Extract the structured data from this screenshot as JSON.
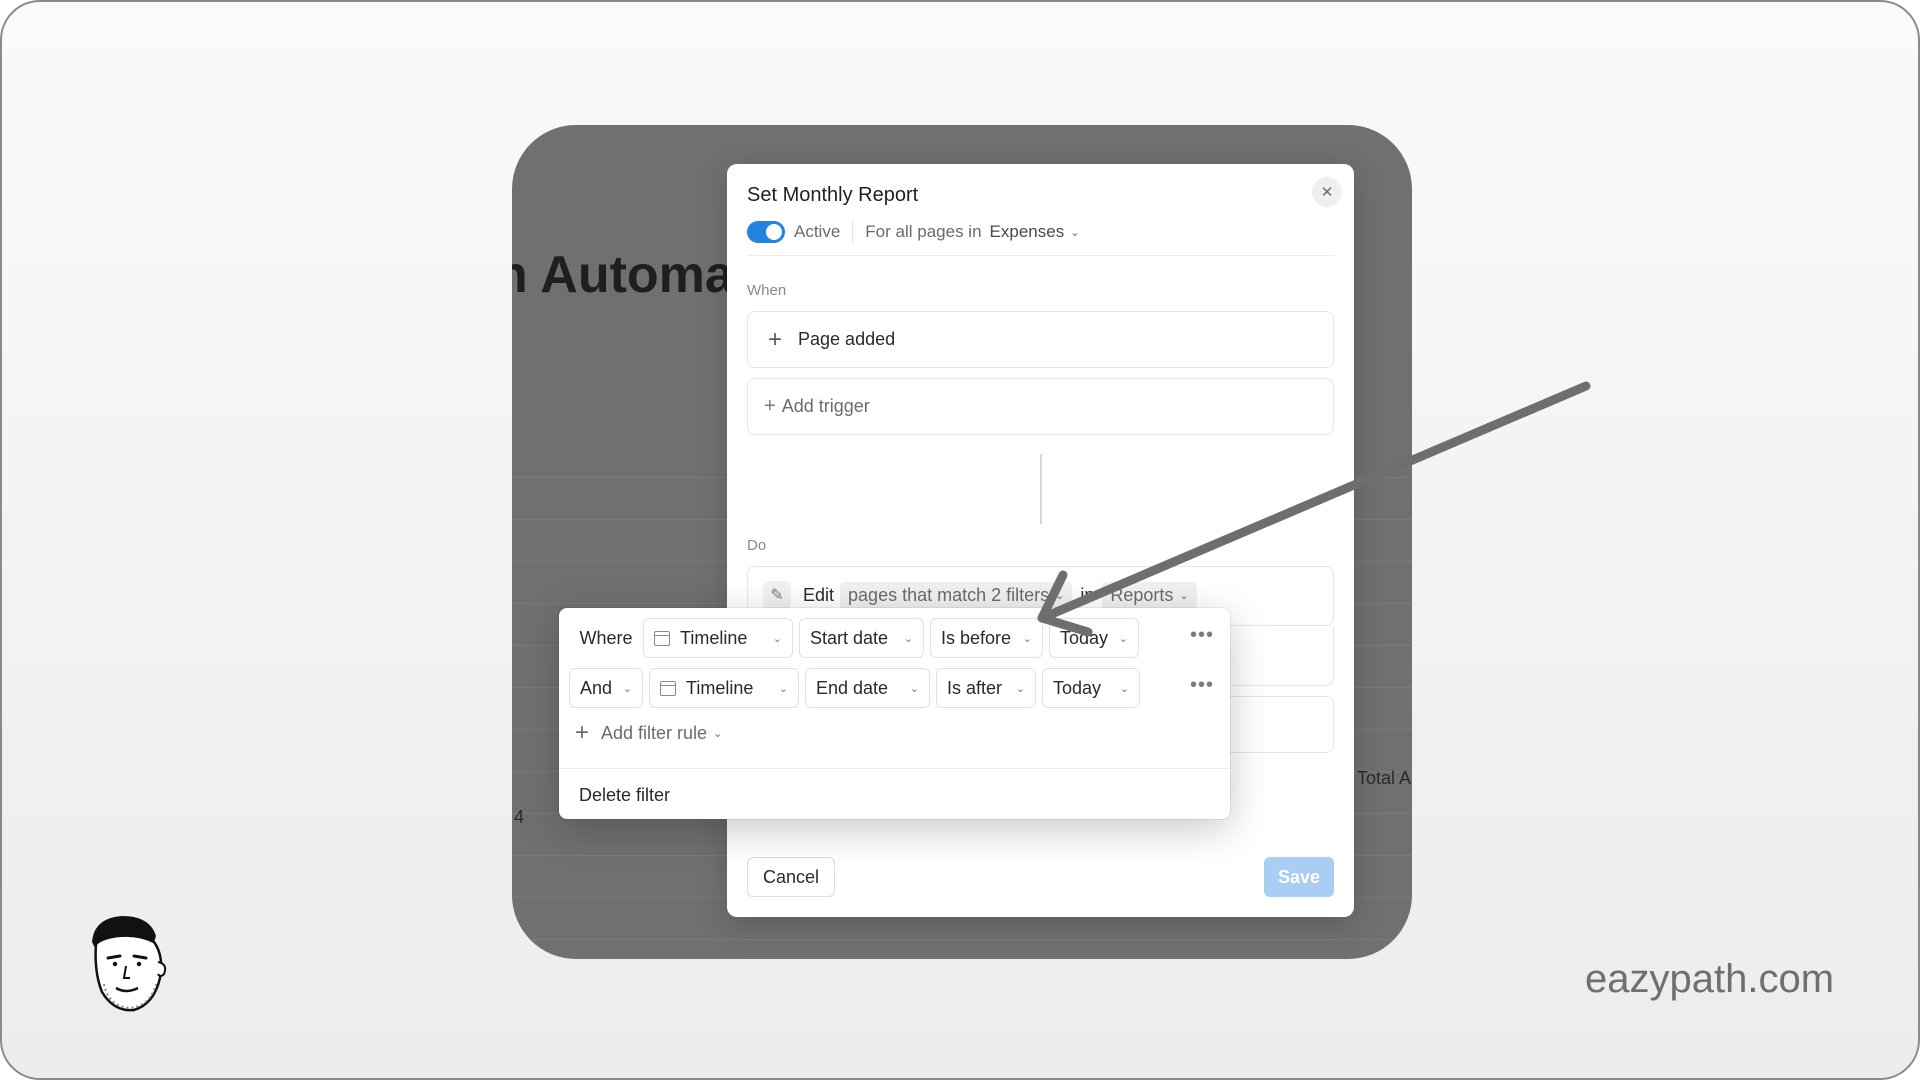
{
  "background": {
    "title_fragment": "n Automa",
    "total_column_fragment": "Total A",
    "row_value_fragment": "4"
  },
  "modal": {
    "title": "Set Monthly Report",
    "active_label": "Active",
    "scope_text": "For all pages in",
    "database": "Expenses",
    "when_label": "When",
    "trigger": "Page added",
    "add_trigger": "Add trigger",
    "do_label": "Do",
    "action": {
      "verb": "Edit",
      "target": "pages that match 2 filters",
      "in_word": "in",
      "database": "Reports"
    },
    "cancel_label": "Cancel",
    "save_label": "Save"
  },
  "filter_popup": {
    "rules": [
      {
        "conjunction": "Where",
        "property": "Timeline",
        "field": "Start date",
        "operator": "Is before",
        "value": "Today"
      },
      {
        "conjunction": "And",
        "property": "Timeline",
        "field": "End date",
        "operator": "Is after",
        "value": "Today"
      }
    ],
    "more_glyph": "•••",
    "add_filter_rule": "Add filter rule",
    "delete_filter": "Delete filter"
  },
  "watermark": "eazypath.com",
  "colors": {
    "accent": "#2383e2",
    "save_disabled": "#a9cdf3",
    "arrow": "#6e6e6e"
  },
  "icons": [
    "close-icon",
    "toggle-switch",
    "plus-icon",
    "edit-icon",
    "calendar-icon",
    "chevron-down-icon",
    "more-icon",
    "annotation-arrow"
  ]
}
